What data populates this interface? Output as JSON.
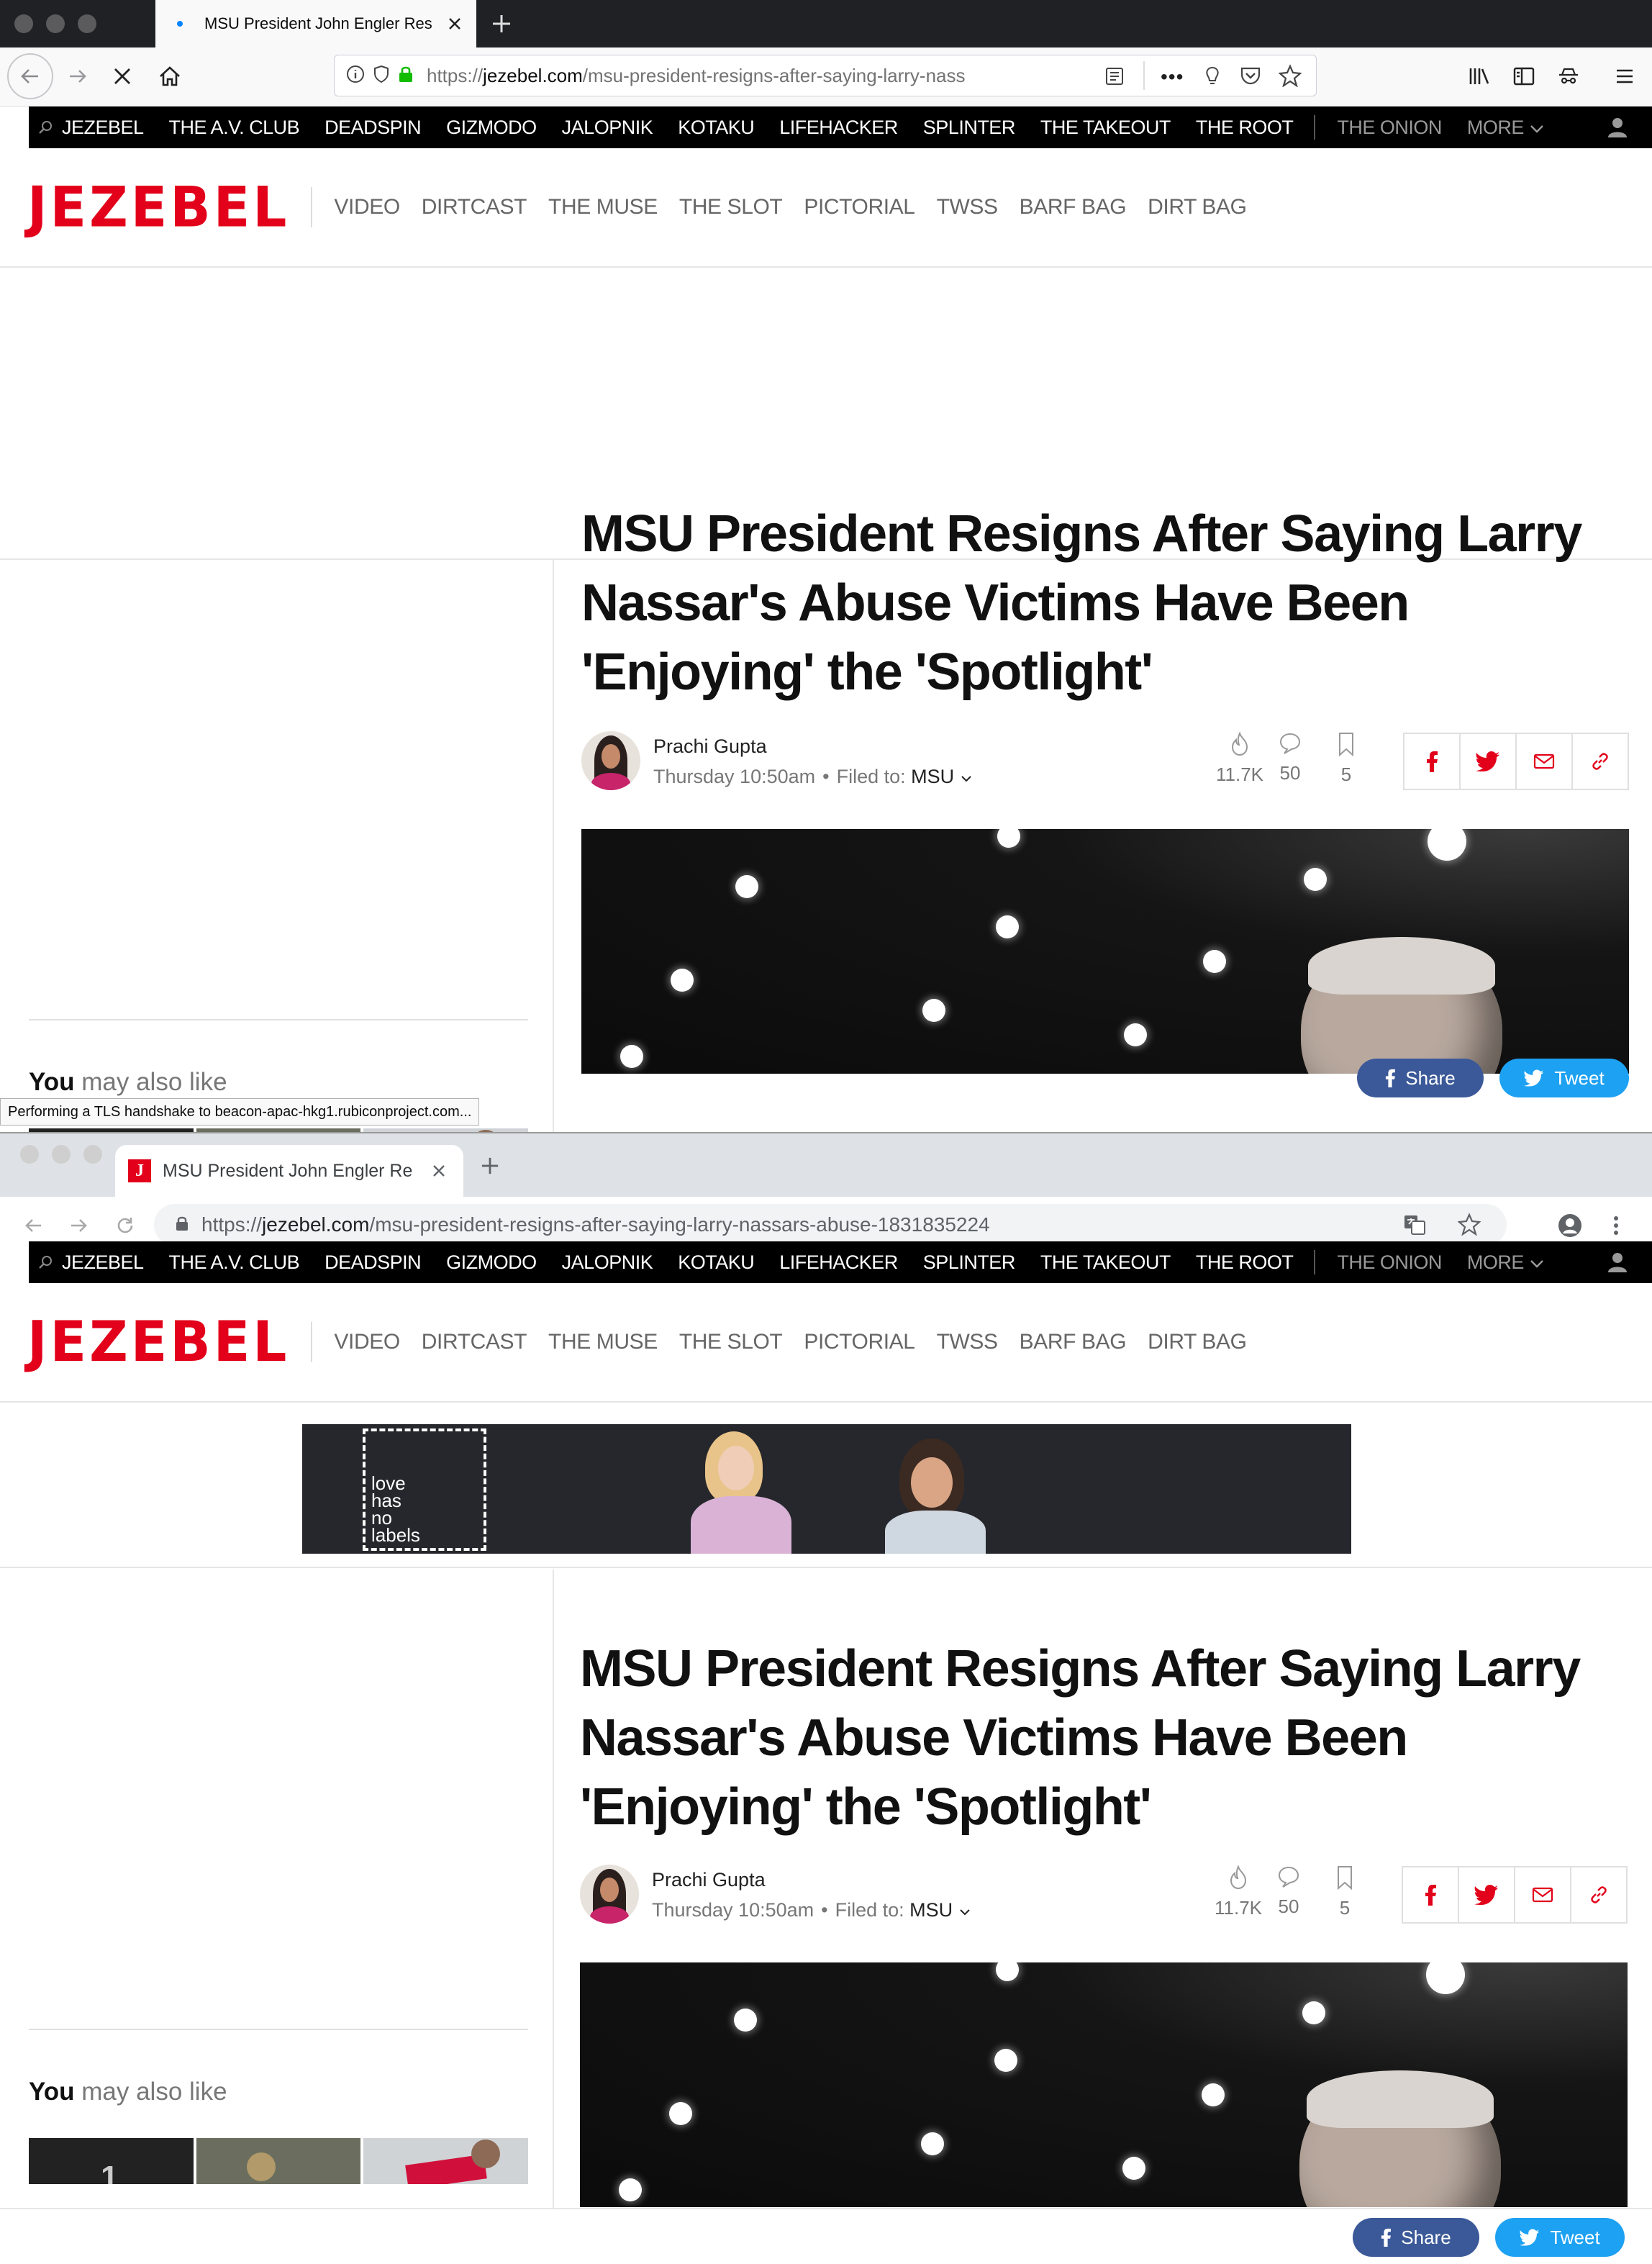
{
  "firefox": {
    "tab_title": "MSU President John Engler Res",
    "url_host": "jezebel.com",
    "url_prefix": "https://",
    "url_path": "/msu-president-resigns-after-saying-larry-nass",
    "status_text": "Performing a TLS handshake to beacon-apac-hkg1.rubiconproject.com..."
  },
  "chrome": {
    "tab_title": "MSU President John Engler Re",
    "favicon_letter": "J",
    "url_host": "jezebel.com",
    "url_prefix": "https://",
    "url_path": "/msu-president-resigns-after-saying-larry-nassars-abuse-1831835224"
  },
  "site": {
    "network_items": [
      "JEZEBEL",
      "THE A.V. CLUB",
      "DEADSPIN",
      "GIZMODO",
      "JALOPNIK",
      "KOTAKU",
      "LIFEHACKER",
      "SPLINTER",
      "THE TAKEOUT",
      "THE ROOT"
    ],
    "network_items_dim": [
      "THE ONION",
      "MORE"
    ],
    "logo": "JEZEBEL",
    "sub_nav": [
      "VIDEO",
      "DIRTCAST",
      "THE MUSE",
      "THE SLOT",
      "PICTORIAL",
      "TWSS",
      "BARF BAG",
      "DIRT BAG"
    ],
    "banner_text": [
      "love",
      "has",
      "no",
      "labels"
    ],
    "headline": "MSU President Resigns After Saying Larry Nassar's Abuse Victims Have Been 'Enjoying' the 'Spotlight'",
    "author": "Prachi Gupta",
    "date": "Thursday 10:50am",
    "filed_label": "Filed to:",
    "filed_tag": "MSU",
    "stats": {
      "views": "11.7K",
      "comments": "50",
      "saves": "5"
    },
    "ymal_bold": "You",
    "ymal_rest": " may also like",
    "share_label": "Share",
    "tweet_label": "Tweet"
  },
  "colors": {
    "brand_red": "#e2001a",
    "facebook": "#3b5998",
    "twitter": "#1da1f2",
    "network_bar": "#000000"
  }
}
